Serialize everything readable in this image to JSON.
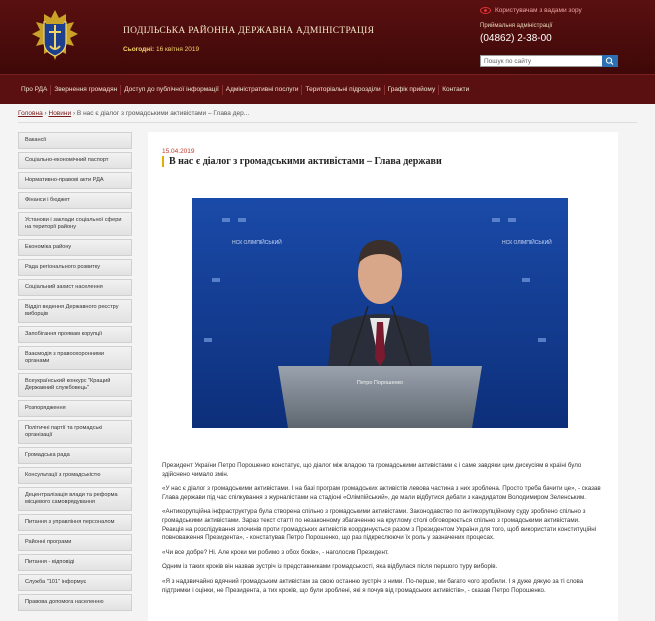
{
  "header": {
    "site_title": "ПОДІЛЬСЬКА РАЙОННА ДЕРЖАВНА АДМІНІСТРАЦІЯ",
    "today_label": "Сьогодні:",
    "today_date": "16 квітня 2019",
    "accessibility_link": "Користувачам з вадами зору",
    "reception_label": "Приймальня адміністрації",
    "phone": "(04862) 2-38-00",
    "search_placeholder": "Пошук по сайту"
  },
  "nav": {
    "items": [
      "Про РДА",
      "Звернення громадян",
      "Доступ до публічної інформації",
      "Адміністративні послуги",
      "Територіальні підрозділи",
      "Графік прийому",
      "Контакти"
    ]
  },
  "breadcrumb": {
    "home": "Головна",
    "news": "Новини",
    "current": "В нас є діалог з громадськими активістами – Глава дер..."
  },
  "sidebar": {
    "items": [
      "Вакансії",
      "Соціально-економічний паспорт",
      "Нормативно-правові акти РДА",
      "Фінанси і бюджет",
      "Установи і заклади соціальної сфери на території району",
      "Економіка району",
      "Рада регіонального розвитку",
      "Соціальний захист населення",
      "Відділ ведення Державного реєстру виборців",
      "Запобігання проявам корупції",
      "Взаємодія з правоохоронними органами",
      "Всеукраїнський конкурс \"Кращий Державний службовець\"",
      "Розпорядження",
      "Політичні партії та громадські організації",
      "Громадська рада",
      "Консультації з громадськістю",
      "Децентралізація влади та реформа місцевого самоврядування",
      "Питання з управління персоналом",
      "Районні програми",
      "Питання - відповіді",
      "Служба \"101\" інформує",
      "Правова допомога населенню"
    ]
  },
  "article": {
    "date": "15.04.2019",
    "title": "В нас є діалог з громадськими активістами – Глава держави",
    "photo_banner": "НСК ОЛІМПІЙСЬКИЙ",
    "podium_label": "Петро Порошенко",
    "paragraphs": [
      "Президент України Петро Порошенко констатує, що діалог між владою та громадськими активістами є і саме завдяки цим дискусіям в країні було здійснено чимало змін.",
      "«У нас є діалог з громадськими активістами. І на базі програм громадських активістів левова частина з них зроблена. Просто треба бачити це», - сказав Глава держави під час спілкування з журналістами на стадіоні «Олімпійський», де мали відбутися дебати з кандидатом Володимиром Зеленським.",
      "«Антикорупційна інфраструктура була створена спільно з громадськими активістами. Законодавство по антикорупційному суду зроблено спільно з громадськими активістами. Зараз текст статті по незаконному збагаченню на круглому столі обговорюється спільно з громадськими активістами. Реакція на розслідування злочинів проти громадських активістів координується разом з Президентом України для того, щоб використати конституційні повноваження Президента», - констатував Петро Порошенко, що раз підкреслюючи їх роль у зазначених процесах.",
      "«Чи все добре? Ні. Але кроки ми робимо з обох боків», - наголосив Президент.",
      "Одним із таких кроків він назвав зустріч із представниками громадськості, яка відбулася після першого туру виборів.",
      "«Я з надзвичайно вдячний громадським активістам за свою останню зустріч з ними. По-перше, ми багато чого зробили. І я дуже дякую за ті слова підтримки і оцінки, не Президента, а тих кроків, що були зроблені, які я почув від громадських активістів», - сказав Петро Порошенко."
    ]
  },
  "colors": {
    "header_bg": "#4a0c0c",
    "accent_gold": "#e0b000",
    "date_red": "#c0392b"
  }
}
